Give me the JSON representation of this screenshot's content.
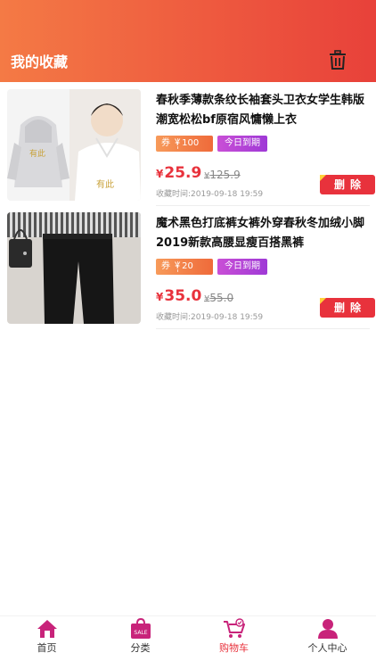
{
  "header": {
    "title": "我的收藏",
    "trash_icon": "trash-icon"
  },
  "items": [
    {
      "title": "春秋季薄款条纹长袖套头卫衣女学生韩版潮宽松松bf原宿风慵懒上衣",
      "coupon": "券 ￥100",
      "expire": "今日到期",
      "price_symbol": "¥",
      "price": "25.9",
      "orig_symbol": "¥",
      "orig_price": "125.9",
      "fav_time": "收藏时间:2019-09-18 19:59",
      "delete_label": "删除"
    },
    {
      "title": "魔术黑色打底裤女裤外穿春秋冬加绒小脚2019新款高腰显瘦百搭黑裤",
      "coupon": "券 ￥20",
      "expire": "今日到期",
      "price_symbol": "¥",
      "price": "35.0",
      "orig_symbol": "¥",
      "orig_price": "55.0",
      "fav_time": "收藏时间:2019-09-18 19:59",
      "delete_label": "删除"
    }
  ],
  "tabbar": {
    "tabs": [
      {
        "label": "首页",
        "icon": "home-icon"
      },
      {
        "label": "分类",
        "icon": "sale-bag-icon",
        "icon_text": "SALE"
      },
      {
        "label": "购物车",
        "icon": "cart-icon",
        "active": true
      },
      {
        "label": "个人中心",
        "icon": "person-icon"
      }
    ]
  },
  "colors": {
    "accent": "#e8323c",
    "header_start": "#f47a45",
    "header_end": "#e8413a",
    "tab_icon": "#c8237a"
  }
}
